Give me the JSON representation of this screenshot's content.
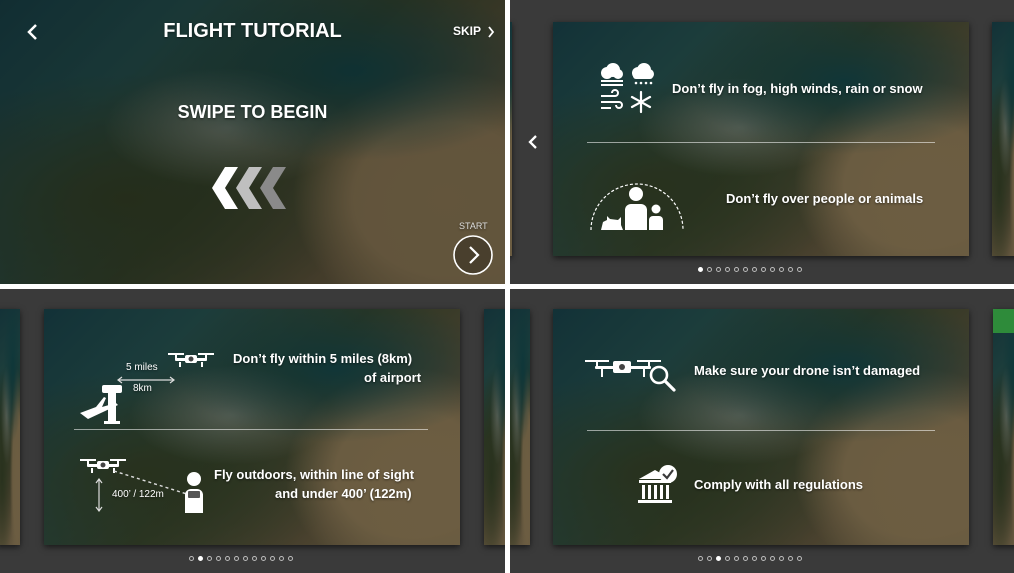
{
  "panel1": {
    "title": "FLIGHT TUTORIAL",
    "skip": "SKIP",
    "swipe": "SWIPE TO BEGIN",
    "start": "START",
    "icons": [
      "back-chevron-icon",
      "swipe-arrows-icon",
      "skip-chevron-icon",
      "start-circle-arrow-icon"
    ]
  },
  "panel2": {
    "rule1": "Don’t fly in fog, high winds, rain or snow",
    "rule2": "Don’t fly over people or animals",
    "page_index": 1,
    "page_count": 12,
    "icons": [
      "back-chevron-icon",
      "weather-icons",
      "people-animals-icon"
    ]
  },
  "panel3": {
    "rule1_line1": "Don’t fly within 5 miles (8km)",
    "rule1_line2": "of airport",
    "miles": "5 miles",
    "km": "8km",
    "rule2_line1": "Fly outdoors, within line of sight",
    "rule2_line2": "and under 400’ (122m)",
    "altitude": "400’ / 122m",
    "page_index": 2,
    "page_count": 12
  },
  "panel4": {
    "rule1": "Make sure your drone isn’t damaged",
    "rule2": "Comply with all regulations",
    "page_index": 3,
    "page_count": 12
  },
  "colors": {
    "accent_green": "#2e8b3a",
    "panel_bg": "#3a3a3a",
    "text": "#ffffff"
  }
}
